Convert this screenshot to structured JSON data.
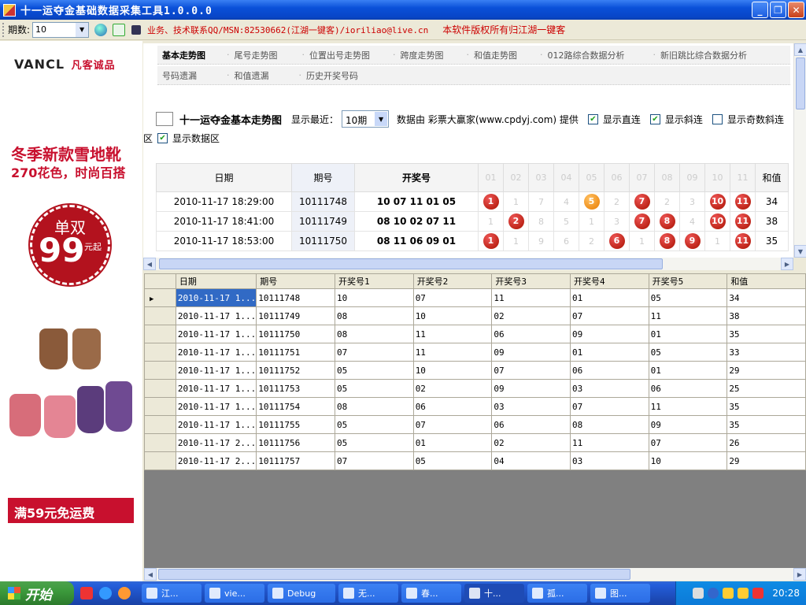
{
  "window": {
    "title": "十一运夺金基础数据采集工具1.0.0.0",
    "minimize_label": "_",
    "restore_label": "❐",
    "close_label": "✕"
  },
  "toolbar": {
    "period_label": "期数:",
    "period_value": "10",
    "contact_text": "业务、技术联系QQ/MSN:82530662(江湖一键客)/ioriliao@live.cn",
    "copyright_text": "本软件版权所有归江湖一键客"
  },
  "ad": {
    "brand": "VANCL",
    "brand_cn": "凡客诚品",
    "headline": "冬季新款雪地靴",
    "subline_num": "270",
    "subline_text": "花色，时尚百搭",
    "circle_top": "单双",
    "circle_price": "99",
    "circle_suffix": "元起",
    "banner": "满59元免运费"
  },
  "nav": {
    "row1": [
      "基本走势图",
      "尾号走势图",
      "位置出号走势图",
      "跨度走势图",
      "和值走势图",
      "012路综合数据分析",
      "新旧跳比综合数据分析"
    ],
    "row2": [
      "号码遗漏",
      "和值遗漏",
      "历史开奖号码"
    ]
  },
  "upper": {
    "chart_title": "十一运夺金基本走势图",
    "show_recent_label": "显示最近：",
    "recent_value": "10期",
    "source_text": "数据由 彩票大赢家(www.cpdyj.com) 提供",
    "cb_direct": "显示直连",
    "cb_slant": "显示斜连",
    "cb_odd": "显示奇数斜连",
    "cb_odd_tail": "区",
    "cb_data": "显示数据区",
    "col_date": "日期",
    "col_period": "期号",
    "col_number": "开奖号",
    "col_sum": "和值",
    "ball_cols": [
      "01",
      "02",
      "03",
      "04",
      "05",
      "06",
      "07",
      "08",
      "09",
      "10",
      "11"
    ],
    "rows": [
      {
        "date": "2010-11-17 18:29:00",
        "period": "10111748",
        "number": "10 07 11 01 05",
        "sum": "34",
        "cells": [
          [
            "1",
            "hit"
          ],
          [
            "1",
            "miss"
          ],
          [
            "7",
            "miss"
          ],
          [
            "4",
            "miss"
          ],
          [
            "5",
            "or"
          ],
          [
            "2",
            "miss"
          ],
          [
            "7",
            "hit"
          ],
          [
            "2",
            "miss"
          ],
          [
            "3",
            "miss"
          ],
          [
            "10",
            "hit"
          ],
          [
            "11",
            "hit"
          ]
        ]
      },
      {
        "date": "2010-11-17 18:41:00",
        "period": "10111749",
        "number": "08 10 02 07 11",
        "sum": "38",
        "cells": [
          [
            "1",
            "miss"
          ],
          [
            "2",
            "hit"
          ],
          [
            "8",
            "miss"
          ],
          [
            "5",
            "miss"
          ],
          [
            "1",
            "miss"
          ],
          [
            "3",
            "miss"
          ],
          [
            "7",
            "hit"
          ],
          [
            "8",
            "hit"
          ],
          [
            "4",
            "miss"
          ],
          [
            "10",
            "hit"
          ],
          [
            "11",
            "hit"
          ]
        ]
      },
      {
        "date": "2010-11-17 18:53:00",
        "period": "10111750",
        "number": "08 11 06 09 01",
        "sum": "35",
        "cells": [
          [
            "1",
            "hit"
          ],
          [
            "1",
            "miss"
          ],
          [
            "9",
            "miss"
          ],
          [
            "6",
            "miss"
          ],
          [
            "2",
            "miss"
          ],
          [
            "6",
            "hit"
          ],
          [
            "1",
            "miss"
          ],
          [
            "8",
            "hit"
          ],
          [
            "9",
            "hit"
          ],
          [
            "1",
            "miss"
          ],
          [
            "11",
            "hit"
          ]
        ]
      }
    ]
  },
  "grid": {
    "headers": [
      "日期",
      "期号",
      "开奖号1",
      "开奖号2",
      "开奖号3",
      "开奖号4",
      "开奖号5",
      "和值"
    ],
    "rows": [
      [
        "2010-11-17 1...",
        "10111748",
        "10",
        "07",
        "11",
        "01",
        "05",
        "34"
      ],
      [
        "2010-11-17 1...",
        "10111749",
        "08",
        "10",
        "02",
        "07",
        "11",
        "38"
      ],
      [
        "2010-11-17 1...",
        "10111750",
        "08",
        "11",
        "06",
        "09",
        "01",
        "35"
      ],
      [
        "2010-11-17 1...",
        "10111751",
        "07",
        "11",
        "09",
        "01",
        "05",
        "33"
      ],
      [
        "2010-11-17 1...",
        "10111752",
        "05",
        "10",
        "07",
        "06",
        "01",
        "29"
      ],
      [
        "2010-11-17 1...",
        "10111753",
        "05",
        "02",
        "09",
        "03",
        "06",
        "25"
      ],
      [
        "2010-11-17 1...",
        "10111754",
        "08",
        "06",
        "03",
        "07",
        "11",
        "35"
      ],
      [
        "2010-11-17 1...",
        "10111755",
        "05",
        "07",
        "06",
        "08",
        "09",
        "35"
      ],
      [
        "2010-11-17 2...",
        "10111756",
        "05",
        "01",
        "02",
        "11",
        "07",
        "26"
      ],
      [
        "2010-11-17 2...",
        "10111757",
        "07",
        "05",
        "04",
        "03",
        "10",
        "29"
      ]
    ]
  },
  "taskbar": {
    "start_label": "开始",
    "tasks": [
      "江...",
      "vie...",
      "Debug",
      "无...",
      "春...",
      "十...",
      "孤...",
      "图..."
    ],
    "active_task_index": 5,
    "clock": "20:28"
  }
}
